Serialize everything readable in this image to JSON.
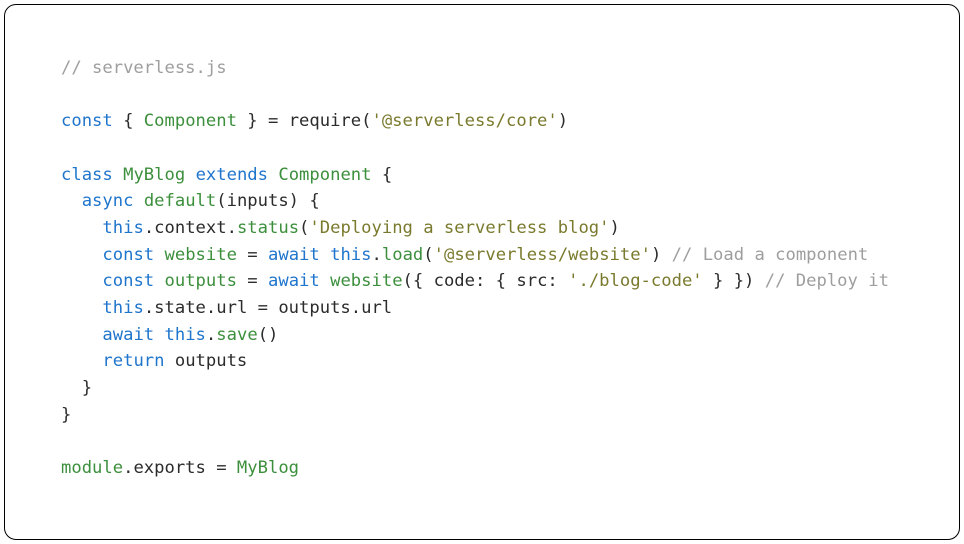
{
  "code": {
    "tokens": [
      {
        "cls": "tok-comment",
        "t": "// serverless.js"
      },
      {
        "nl": 1
      },
      {
        "nl": 1
      },
      {
        "cls": "tok-keyword",
        "t": "const"
      },
      {
        "cls": "tok-punct",
        "t": " { "
      },
      {
        "cls": "tok-def",
        "t": "Component"
      },
      {
        "cls": "tok-punct",
        "t": " } = "
      },
      {
        "cls": "tok-ident",
        "t": "require"
      },
      {
        "cls": "tok-punct",
        "t": "("
      },
      {
        "cls": "tok-string",
        "t": "'@serverless/core'"
      },
      {
        "cls": "tok-punct",
        "t": ")"
      },
      {
        "nl": 1
      },
      {
        "nl": 1
      },
      {
        "cls": "tok-keyword",
        "t": "class"
      },
      {
        "cls": "tok-punct",
        "t": " "
      },
      {
        "cls": "tok-def",
        "t": "MyBlog"
      },
      {
        "cls": "tok-punct",
        "t": " "
      },
      {
        "cls": "tok-keyword",
        "t": "extends"
      },
      {
        "cls": "tok-punct",
        "t": " "
      },
      {
        "cls": "tok-def",
        "t": "Component"
      },
      {
        "cls": "tok-punct",
        "t": " {"
      },
      {
        "nl": 1
      },
      {
        "cls": "tok-punct",
        "t": "  "
      },
      {
        "cls": "tok-keyword",
        "t": "async"
      },
      {
        "cls": "tok-punct",
        "t": " "
      },
      {
        "cls": "tok-def",
        "t": "default"
      },
      {
        "cls": "tok-punct",
        "t": "(inputs) {"
      },
      {
        "nl": 1
      },
      {
        "cls": "tok-punct",
        "t": "    "
      },
      {
        "cls": "tok-keyword",
        "t": "this"
      },
      {
        "cls": "tok-punct",
        "t": ".context."
      },
      {
        "cls": "tok-def",
        "t": "status"
      },
      {
        "cls": "tok-punct",
        "t": "("
      },
      {
        "cls": "tok-string",
        "t": "'Deploying a serverless blog'"
      },
      {
        "cls": "tok-punct",
        "t": ")"
      },
      {
        "nl": 1
      },
      {
        "cls": "tok-punct",
        "t": "    "
      },
      {
        "cls": "tok-keyword",
        "t": "const"
      },
      {
        "cls": "tok-punct",
        "t": " "
      },
      {
        "cls": "tok-def",
        "t": "website"
      },
      {
        "cls": "tok-punct",
        "t": " = "
      },
      {
        "cls": "tok-keyword",
        "t": "await"
      },
      {
        "cls": "tok-punct",
        "t": " "
      },
      {
        "cls": "tok-keyword",
        "t": "this"
      },
      {
        "cls": "tok-punct",
        "t": "."
      },
      {
        "cls": "tok-def",
        "t": "load"
      },
      {
        "cls": "tok-punct",
        "t": "("
      },
      {
        "cls": "tok-string",
        "t": "'@serverless/website'"
      },
      {
        "cls": "tok-punct",
        "t": ") "
      },
      {
        "cls": "tok-comment",
        "t": "// Load a component"
      },
      {
        "nl": 1
      },
      {
        "cls": "tok-punct",
        "t": "    "
      },
      {
        "cls": "tok-keyword",
        "t": "const"
      },
      {
        "cls": "tok-punct",
        "t": " "
      },
      {
        "cls": "tok-def",
        "t": "outputs"
      },
      {
        "cls": "tok-punct",
        "t": " = "
      },
      {
        "cls": "tok-keyword",
        "t": "await"
      },
      {
        "cls": "tok-punct",
        "t": " "
      },
      {
        "cls": "tok-def",
        "t": "website"
      },
      {
        "cls": "tok-punct",
        "t": "({ code: { src: "
      },
      {
        "cls": "tok-string",
        "t": "'./blog-code'"
      },
      {
        "cls": "tok-punct",
        "t": " } }) "
      },
      {
        "cls": "tok-comment",
        "t": "// Deploy it"
      },
      {
        "nl": 1
      },
      {
        "cls": "tok-punct",
        "t": "    "
      },
      {
        "cls": "tok-keyword",
        "t": "this"
      },
      {
        "cls": "tok-punct",
        "t": ".state.url = outputs.url"
      },
      {
        "nl": 1
      },
      {
        "cls": "tok-punct",
        "t": "    "
      },
      {
        "cls": "tok-keyword",
        "t": "await"
      },
      {
        "cls": "tok-punct",
        "t": " "
      },
      {
        "cls": "tok-keyword",
        "t": "this"
      },
      {
        "cls": "tok-punct",
        "t": "."
      },
      {
        "cls": "tok-def",
        "t": "save"
      },
      {
        "cls": "tok-punct",
        "t": "()"
      },
      {
        "nl": 1
      },
      {
        "cls": "tok-punct",
        "t": "    "
      },
      {
        "cls": "tok-keyword",
        "t": "return"
      },
      {
        "cls": "tok-punct",
        "t": " outputs"
      },
      {
        "nl": 1
      },
      {
        "cls": "tok-punct",
        "t": "  }"
      },
      {
        "nl": 1
      },
      {
        "cls": "tok-punct",
        "t": "}"
      },
      {
        "nl": 1
      },
      {
        "nl": 1
      },
      {
        "cls": "tok-def",
        "t": "module"
      },
      {
        "cls": "tok-punct",
        "t": ".exports = "
      },
      {
        "cls": "tok-def",
        "t": "MyBlog"
      }
    ]
  }
}
